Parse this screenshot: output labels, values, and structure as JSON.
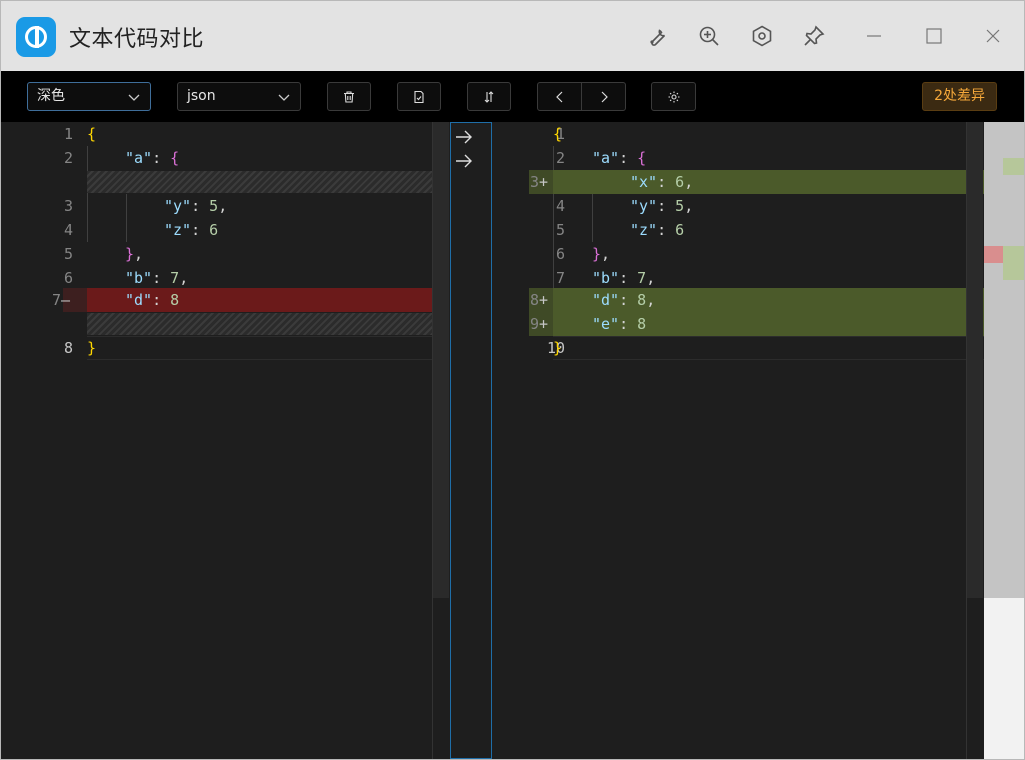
{
  "app": {
    "title": "文本代码对比",
    "icons": [
      "wrench-icon",
      "zoom-in-icon",
      "hexagon-settings-icon",
      "pin-icon",
      "minimize-icon",
      "maximize-icon",
      "close-icon"
    ]
  },
  "toolbar": {
    "theme_select": "深色",
    "language_select": "json",
    "diff_count": "2处差异",
    "buttons": [
      "trash-icon",
      "save-check-icon",
      "swap-vertical-icon",
      "chevron-left-icon",
      "chevron-right-icon",
      "gear-icon"
    ],
    "accent_color": "#f5a83a"
  },
  "left_editor": {
    "line_numbers": [
      "1",
      "2",
      "3",
      "4",
      "5",
      "6",
      "7",
      "8"
    ],
    "deleted_marker": "—",
    "lines": {
      "l1": "{",
      "l2_key": "\"a\"",
      "l2_sep": ": ",
      "l2_brace": "{",
      "l3_key": "\"y\"",
      "l3_sep": ": ",
      "l3_val": "5",
      "l3_end": ",",
      "l4_key": "\"z\"",
      "l4_sep": ": ",
      "l4_val": "6",
      "l5_brace": "}",
      "l5_end": ",",
      "l6_key": "\"b\"",
      "l6_sep": ": ",
      "l6_val": "7",
      "l6_end": ",",
      "l7_key": "\"d\"",
      "l7_sep": ": ",
      "l7_val": "8",
      "l8": "}"
    }
  },
  "right_editor": {
    "line_numbers": [
      "1",
      "2",
      "3",
      "4",
      "5",
      "6",
      "7",
      "8",
      "9",
      "10"
    ],
    "added_marker": "+",
    "lines": {
      "l1": "{",
      "l2_key": "\"a\"",
      "l2_sep": ": ",
      "l2_brace": "{",
      "l3_key": "\"x\"",
      "l3_sep": ": ",
      "l3_val": "6",
      "l3_end": ",",
      "l4_key": "\"y\"",
      "l4_sep": ": ",
      "l4_val": "5",
      "l4_end": ",",
      "l5_key": "\"z\"",
      "l5_sep": ": ",
      "l5_val": "6",
      "l6_brace": "}",
      "l6_end": ",",
      "l7_key": "\"b\"",
      "l7_sep": ": ",
      "l7_val": "7",
      "l7_end": ",",
      "l8_key": "\"d\"",
      "l8_sep": ": ",
      "l8_val": "8",
      "l8_end": ",",
      "l9_key": "\"e\"",
      "l9_sep": ": ",
      "l9_val": "8",
      "l10": "}"
    }
  },
  "middle": {
    "arrows": [
      "arrow-right-icon",
      "arrow-right-icon"
    ]
  },
  "colors": {
    "deleted_bg": "#6b1a1a",
    "added_bg": "#4b5a2a",
    "brace_gold": "#ffd700",
    "brace_purple": "#da70d6",
    "key_blue": "#9cdcfe",
    "number_green": "#b5cea8"
  }
}
